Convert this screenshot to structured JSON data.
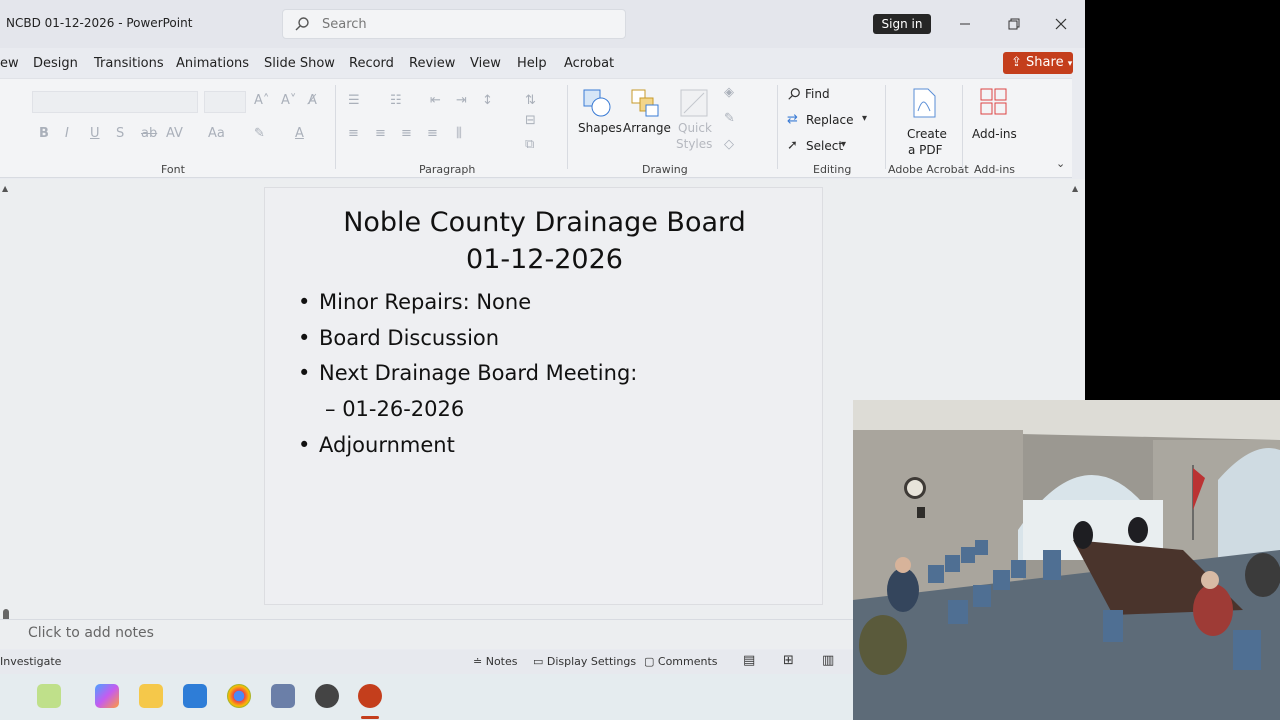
{
  "window": {
    "title": "NCBD 01-12-2026  -  PowerPoint"
  },
  "search": {
    "placeholder": "Search"
  },
  "account": {
    "signin_label": "Sign in"
  },
  "tabs": [
    {
      "label": "ew"
    },
    {
      "label": "Design"
    },
    {
      "label": "Transitions"
    },
    {
      "label": "Animations"
    },
    {
      "label": "Slide Show"
    },
    {
      "label": "Record"
    },
    {
      "label": "Review"
    },
    {
      "label": "View"
    },
    {
      "label": "Help"
    },
    {
      "label": "Acrobat"
    }
  ],
  "share": {
    "label": "Share"
  },
  "ribbon": {
    "groups": {
      "font": "Font",
      "paragraph": "Paragraph",
      "drawing": "Drawing",
      "editing": "Editing",
      "adobe": "Adobe Acrobat",
      "addins": "Add-ins"
    },
    "drawing": {
      "shapes": "Shapes",
      "arrange": "Arrange",
      "quick1": "Quick",
      "quick2": "Styles"
    },
    "editing": {
      "find": "Find",
      "replace": "Replace",
      "select": "Select"
    },
    "adobe": {
      "create1": "Create",
      "create2": "a PDF"
    },
    "addins": {
      "label": "Add-ins"
    }
  },
  "slide": {
    "title_line1": "Noble County Drainage Board",
    "title_line2": "01-12-2026",
    "bullets": [
      "Minor Repairs: None",
      "Board Discussion",
      "Next Drainage Board Meeting:",
      "Adjournment"
    ],
    "sub_bullet": "01-26-2026"
  },
  "notes": {
    "placeholder": "Click to add notes"
  },
  "statusbar": {
    "left": "Investigate",
    "notes": "Notes",
    "display": "Display Settings",
    "comments": "Comments"
  },
  "colors": {
    "share": "#c43e1c",
    "accent": "#c43e1c"
  }
}
